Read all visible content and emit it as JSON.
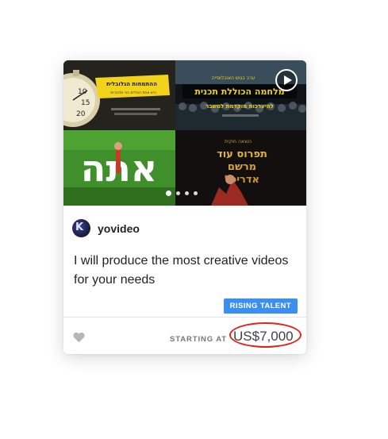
{
  "gig": {
    "seller_name": "yovideo",
    "title": "I will produce the most creative videos for your needs",
    "badge": "RISING TALENT",
    "starting_at": "STARTING AT",
    "price": "US$7,000",
    "gallery": {
      "current_slide": 1,
      "total_slides": 4,
      "thumbnails": [
        {
          "text": "ההתמחות הגלובלית",
          "subtext": "היא אחת המילים הכי מדוברות"
        },
        {
          "text": "מלחמה הכוללת תכנית",
          "subtext": "להיערכות מוקדמת למשבר"
        },
        {
          "text": "אתה"
        },
        {
          "text": "תפרוס עוד"
        }
      ]
    }
  },
  "icons": {
    "play": "play-icon",
    "favorite": "heart-icon",
    "avatar": "avatar"
  },
  "colors": {
    "badge": "#3b8ff0",
    "annotation_circle": "#e0241b",
    "heart": "#b5b6ba",
    "text": "#222325"
  }
}
